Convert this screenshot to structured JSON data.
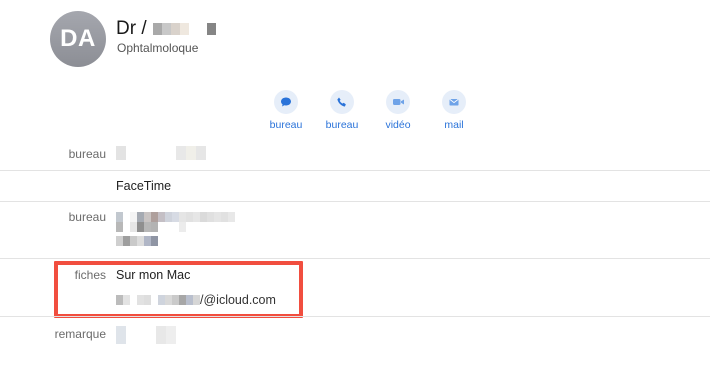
{
  "contact": {
    "initials": "DA",
    "name_prefix": "Dr /",
    "title": "Ophtalmoloque"
  },
  "actions": [
    {
      "label": "bureau",
      "icon": "message-icon"
    },
    {
      "label": "bureau",
      "icon": "phone-icon"
    },
    {
      "label": "vidéo",
      "icon": "video-icon"
    },
    {
      "label": "mail",
      "icon": "mail-icon"
    }
  ],
  "fields": {
    "phone_label": "bureau",
    "facetime_value": "FaceTime",
    "address_label": "bureau",
    "cards_label": "fiches",
    "cards_value": "Sur mon Mac",
    "email_suffix": "/@icloud.com",
    "note_label": "remarque"
  },
  "colors": {
    "accent": "#2a73d9",
    "highlight_border": "#f14e3f",
    "avatar_bg": "#9a9ca3"
  }
}
